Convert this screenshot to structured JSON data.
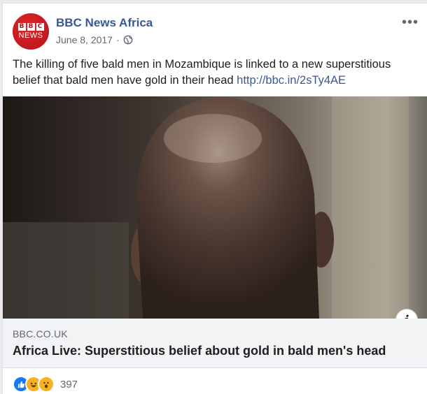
{
  "post": {
    "page_name": "BBC News Africa",
    "date": "June 8, 2017",
    "separator": "·",
    "avatar_top": "BBC",
    "avatar_bottom": "NEWS",
    "text": "The killing of five bald men in Mozambique is linked to a new superstitious belief that bald men have gold in their head ",
    "link_text": "http://bbc.in/2sTy4AE",
    "more_icon": "•••"
  },
  "link_preview": {
    "domain": "BBC.CO.UK",
    "headline": "Africa Live: Superstitious belief about gold in bald men's head",
    "info_icon": "i"
  },
  "reactions": {
    "icons": [
      "like-icon",
      "haha-icon",
      "wow-icon"
    ],
    "count": "397"
  },
  "colors": {
    "link_blue": "#385898",
    "like_blue": "#1877f2",
    "emoji_yellow": "#f7b125",
    "bbc_red": "#b3131a"
  }
}
